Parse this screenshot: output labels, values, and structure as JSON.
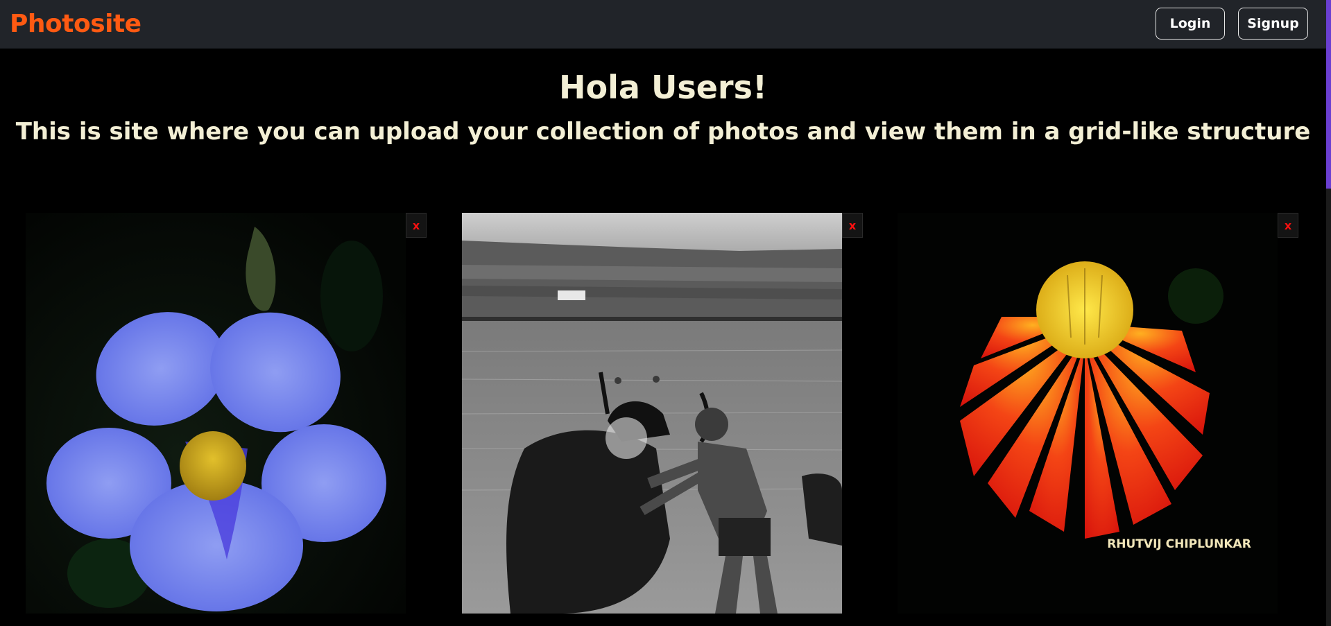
{
  "navbar": {
    "brand": "Photosite",
    "login_label": "Login",
    "signup_label": "Signup"
  },
  "hero": {
    "title": "Hola Users!",
    "subtitle": "This is site where you can upload your collection of photos and view them in a grid-like structure"
  },
  "photos": [
    {
      "subject": "blue-flower-photo",
      "delete_label": "x"
    },
    {
      "subject": "man-washing-buffalo-bw-photo",
      "delete_label": "x"
    },
    {
      "subject": "red-flower-photo",
      "delete_label": "x",
      "watermark": "RHUTVIJ CHIPLUNKAR"
    }
  ],
  "colors": {
    "brand": "#ff5a12",
    "navbar_bg": "#212429",
    "page_bg": "#000000",
    "hero_text": "#f3efd5",
    "delete_icon": "#ff1010",
    "scroll_thumb": "#6a3fd1"
  }
}
